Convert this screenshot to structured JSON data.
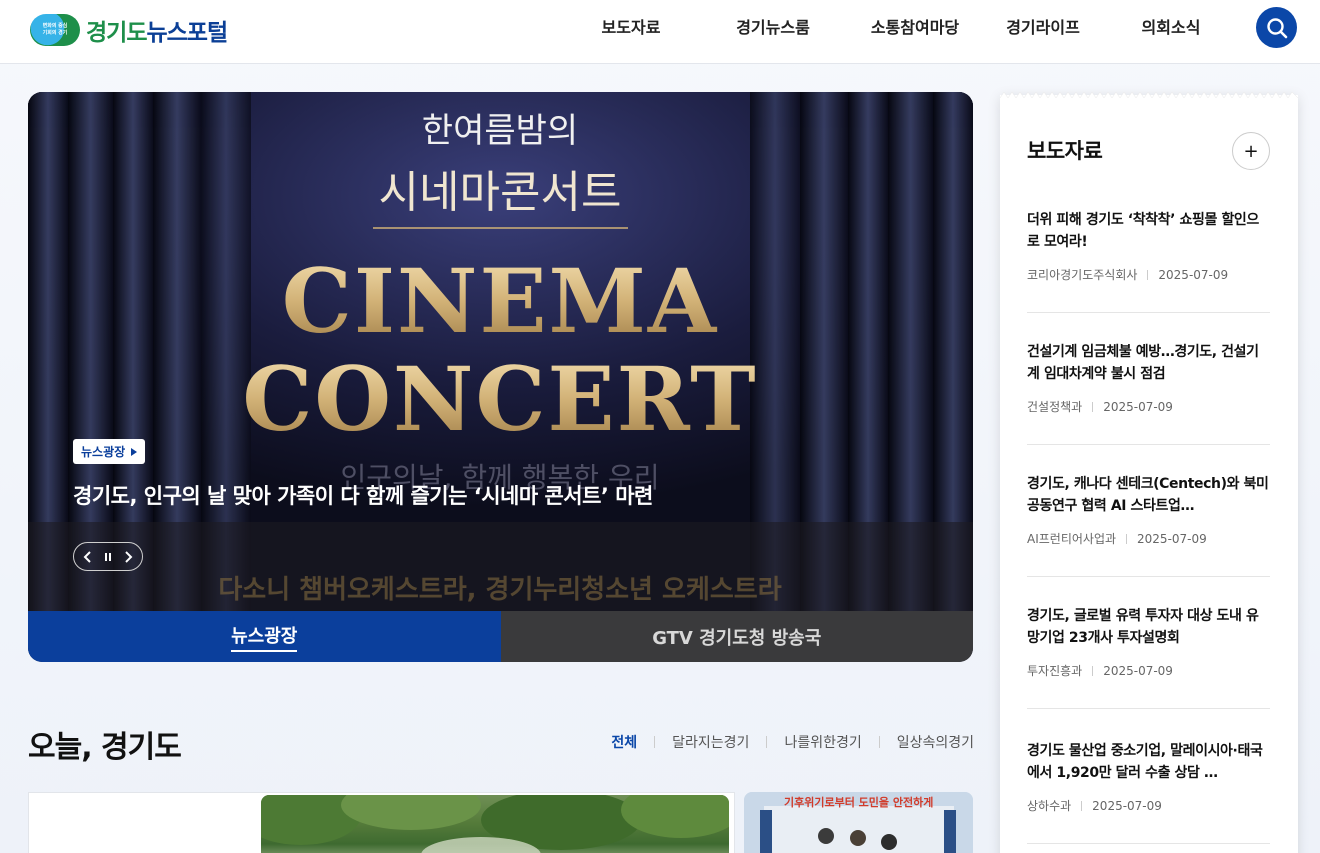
{
  "header": {
    "logo_badge": "변화의 중심\n기회의 경기",
    "logo_green": "경기도",
    "logo_blue": "뉴스포털",
    "nav": [
      "보도자료",
      "경기뉴스룸",
      "소통참여마당",
      "경기라이프",
      "의회소식"
    ],
    "search_icon": "search-icon"
  },
  "hero": {
    "poster_line1": "한여름밤의",
    "poster_line2": "시네마콘서트",
    "poster_line3": "CINEMA",
    "poster_line4": "CONCERT",
    "poster_line5": "인구의날, 함께 행복한 우리",
    "poster_line6": "다소니 챔버오케스트라, 경기누리청소년 오케스트라",
    "badge": "뉴스광장",
    "caption": "경기도, 인구의 날 맞아 가족이 다 함께 즐기는 ‘시네마 콘서트’ 마련",
    "tabs": [
      "뉴스광장",
      "GTV 경기도청 방송국"
    ]
  },
  "press": {
    "title": "보도자료",
    "more": "+",
    "items": [
      {
        "title": "더위 피해 경기도 ‘착착착’ 쇼핑몰 할인으로 모여라!",
        "dept": "코리아경기도주식회사",
        "date": "2025-07-09"
      },
      {
        "title": "건설기계 임금체불 예방…경기도, 건설기계 임대차계약 불시 점검",
        "dept": "건설정책과",
        "date": "2025-07-09"
      },
      {
        "title": "경기도, 캐나다 센테크(Centech)와 북미 공동연구 협력 AI 스타트업…",
        "dept": "AI프런티어사업과",
        "date": "2025-07-09"
      },
      {
        "title": "경기도, 글로벌 유력 투자자 대상 도내 유망기업 23개사 투자설명회",
        "dept": "투자진흥과",
        "date": "2025-07-09"
      },
      {
        "title": "경기도 물산업 중소기업, 말레이시아·태국에서 1,920만 달러 수출 상담 …",
        "dept": "상하수과",
        "date": "2025-07-09"
      }
    ]
  },
  "today": {
    "title": "오늘, 경기도",
    "tabs": [
      "전체",
      "달라지는경기",
      "나를위한경기",
      "일상속의경기"
    ],
    "banner": "기후위기로부터 도민을 안전하게"
  }
}
